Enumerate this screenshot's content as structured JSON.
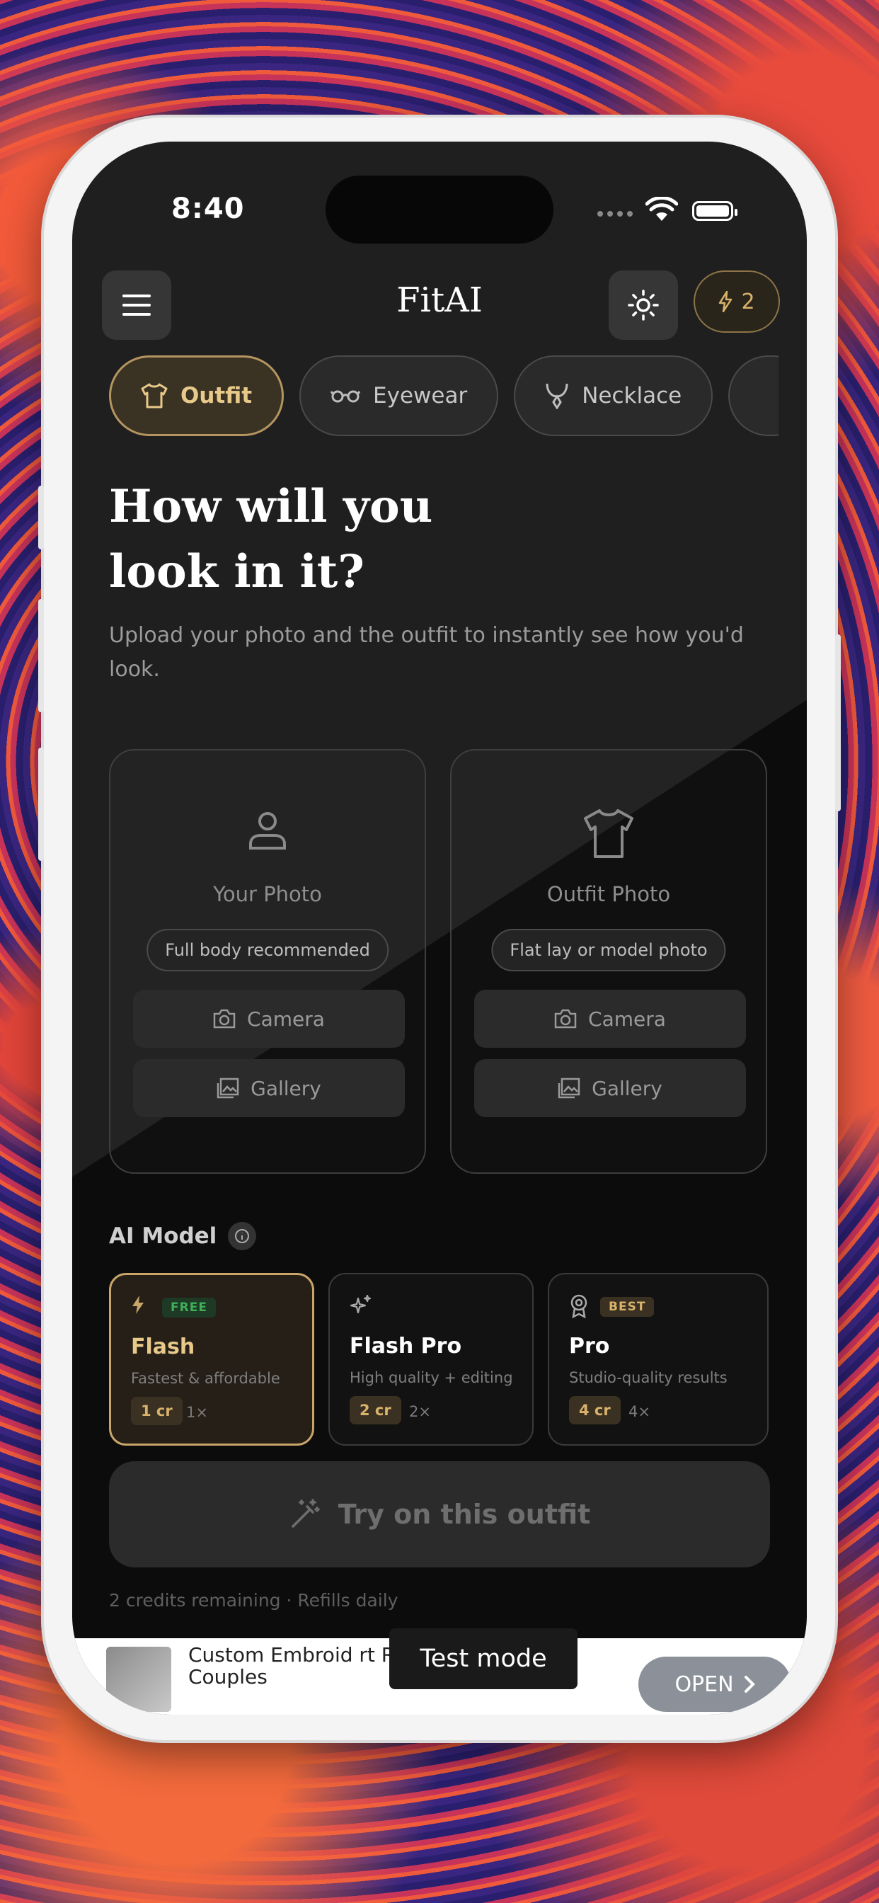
{
  "status": {
    "time": "8:40"
  },
  "header": {
    "title": "FitAI",
    "credits": "2"
  },
  "categories": [
    {
      "label": "Outfit",
      "active": true
    },
    {
      "label": "Eyewear",
      "active": false
    },
    {
      "label": "Necklace",
      "active": false
    }
  ],
  "hero": {
    "headline_line1": "How will you",
    "headline_line2": "look in it?",
    "subtitle": "Upload your photo and the outfit to instantly see how you'd look."
  },
  "upload_cards": [
    {
      "label": "Your Photo",
      "hint": "Full body recommended",
      "camera": "Camera",
      "gallery": "Gallery"
    },
    {
      "label": "Outfit Photo",
      "hint": "Flat lay or model photo",
      "camera": "Camera",
      "gallery": "Gallery"
    }
  ],
  "ai_model": {
    "label": "AI Model",
    "models": [
      {
        "name": "Flash",
        "desc": "Fastest & affordable",
        "badge": "FREE",
        "cost": "1 cr",
        "mult": "1×",
        "selected": true
      },
      {
        "name": "Flash Pro",
        "desc": "High quality + editing",
        "badge": "",
        "cost": "2 cr",
        "mult": "2×",
        "selected": false
      },
      {
        "name": "Pro",
        "desc": "Studio-quality results",
        "badge": "BEST",
        "cost": "4 cr",
        "mult": "4×",
        "selected": false
      }
    ]
  },
  "cta": {
    "label": "Try on this outfit",
    "remaining": "2 credits remaining · Refills daily"
  },
  "ad": {
    "text": "Custom Embroid      rt Roman Numera      For Couples",
    "open": "OPEN",
    "test_mode": "Test mode"
  },
  "colors": {
    "accent": "#c9a56a",
    "free_badge": "#3fae5a",
    "best_badge": "#d9b26b"
  }
}
